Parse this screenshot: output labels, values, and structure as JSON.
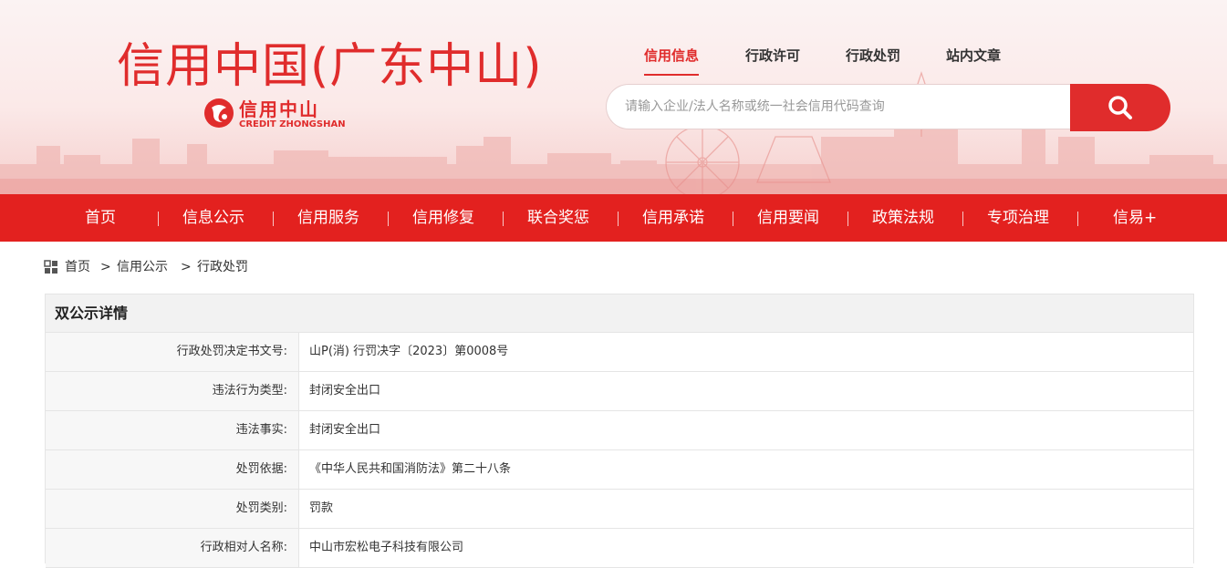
{
  "header": {
    "site_title": "信用中国(广东中山)",
    "logo_cn": "信用中山",
    "logo_en": "CREDIT ZHONGSHAN"
  },
  "top_nav": [
    {
      "label": "信用信息",
      "active": true
    },
    {
      "label": "行政许可",
      "active": false
    },
    {
      "label": "行政处罚",
      "active": false
    },
    {
      "label": "站内文章",
      "active": false
    }
  ],
  "search": {
    "placeholder": "请输入企业/法人名称或统一社会信用代码查询",
    "button_icon": "search-icon"
  },
  "main_nav": [
    {
      "label": "首页"
    },
    {
      "label": "信息公示"
    },
    {
      "label": "信用服务"
    },
    {
      "label": "信用修复"
    },
    {
      "label": "联合奖惩"
    },
    {
      "label": "信用承诺"
    },
    {
      "label": "信用要闻"
    },
    {
      "label": "政策法规"
    },
    {
      "label": "专项治理"
    },
    {
      "label": "信易+"
    }
  ],
  "breadcrumb": {
    "icon": "grid-icon",
    "items": [
      "首页",
      "信用公示",
      "行政处罚"
    ],
    "separator": ">"
  },
  "detail": {
    "title": "双公示详情",
    "rows": [
      {
        "label": "行政处罚决定书文号:",
        "value": "山P(消) 行罚决字〔2023〕第0008号"
      },
      {
        "label": "违法行为类型:",
        "value": "封闭安全出口"
      },
      {
        "label": "违法事实:",
        "value": "封闭安全出口"
      },
      {
        "label": "处罚依据:",
        "value": "《中华人民共和国消防法》第二十八条"
      },
      {
        "label": "处罚类别:",
        "value": "罚款"
      },
      {
        "label": "行政相对人名称:",
        "value": "中山市宏松电子科技有限公司"
      }
    ]
  },
  "colors": {
    "brand_red": "#e3211f",
    "title_red": "#e02c2c"
  }
}
